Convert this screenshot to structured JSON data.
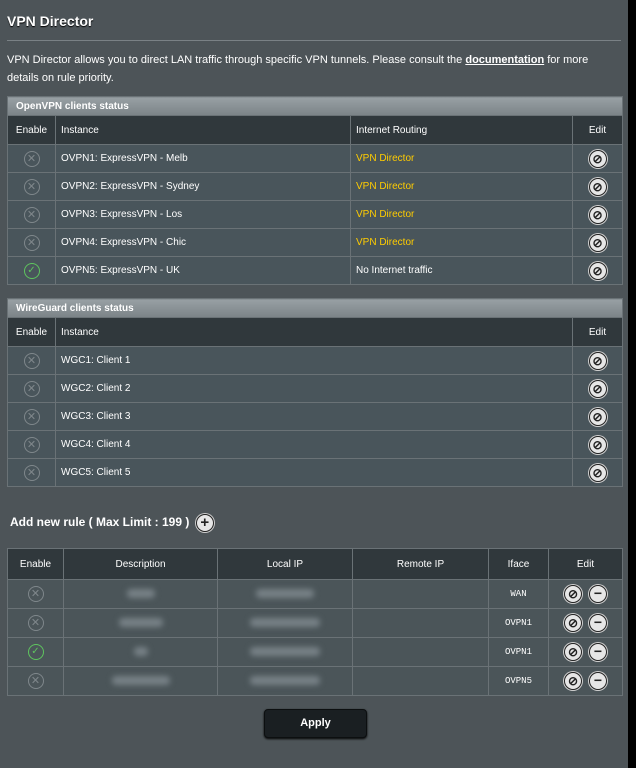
{
  "page": {
    "title": "VPN Director",
    "intro_before": "VPN Director allows you to direct LAN traffic through specific VPN tunnels. Please consult the ",
    "intro_link": "documentation",
    "intro_after": " for more details on rule priority."
  },
  "openvpn": {
    "section_title": "OpenVPN clients status",
    "headers": {
      "enable": "Enable",
      "instance": "Instance",
      "routing": "Internet Routing",
      "edit": "Edit"
    },
    "rows": [
      {
        "enabled": false,
        "instance": "OVPN1: ExpressVPN - Melb",
        "routing": "VPN Director",
        "routing_color": "#ffcc00"
      },
      {
        "enabled": false,
        "instance": "OVPN2: ExpressVPN - Sydney",
        "routing": "VPN Director",
        "routing_color": "#ffcc00"
      },
      {
        "enabled": false,
        "instance": "OVPN3: ExpressVPN - Los",
        "routing": "VPN Director",
        "routing_color": "#ffcc00"
      },
      {
        "enabled": false,
        "instance": "OVPN4: ExpressVPN - Chic",
        "routing": "VPN Director",
        "routing_color": "#ffcc00"
      },
      {
        "enabled": true,
        "instance": "OVPN5: ExpressVPN - UK",
        "routing": "No Internet traffic",
        "routing_color": "#ffffff"
      }
    ]
  },
  "wireguard": {
    "section_title": "WireGuard clients status",
    "headers": {
      "enable": "Enable",
      "instance": "Instance",
      "edit": "Edit"
    },
    "rows": [
      {
        "enabled": false,
        "instance": "WGC1: Client 1"
      },
      {
        "enabled": false,
        "instance": "WGC2: Client 2"
      },
      {
        "enabled": false,
        "instance": "WGC3: Client 3"
      },
      {
        "enabled": false,
        "instance": "WGC4: Client 4"
      },
      {
        "enabled": false,
        "instance": "WGC5: Client 5"
      }
    ]
  },
  "rules": {
    "add_label": "Add new rule ( Max Limit : 199 )",
    "headers": {
      "enable": "Enable",
      "description": "Description",
      "local_ip": "Local IP",
      "remote_ip": "Remote IP",
      "iface": "Iface",
      "edit": "Edit"
    },
    "rows": [
      {
        "enabled": false,
        "iface": "WAN"
      },
      {
        "enabled": false,
        "iface": "OVPN1"
      },
      {
        "enabled": true,
        "iface": "OVPN1"
      },
      {
        "enabled": false,
        "iface": "OVPN5"
      }
    ]
  },
  "icons": {
    "disabled": "disabled-x-icon",
    "enabled": "enabled-check-icon",
    "edit": "pencil-edit-icon",
    "delete": "minus-delete-icon",
    "add": "plus-add-icon"
  },
  "apply_label": "Apply"
}
